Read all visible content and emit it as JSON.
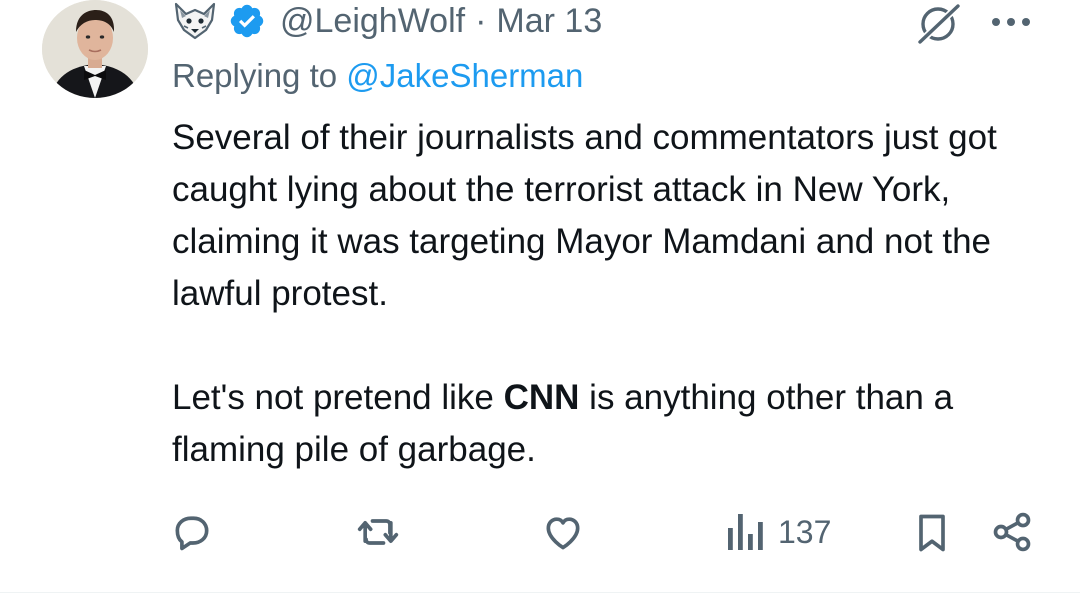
{
  "tweet": {
    "handle": "@LeighWolf",
    "separator": "·",
    "date": "Mar 13",
    "replying_prefix": "Replying to ",
    "replying_to": "@JakeSherman",
    "para1": "Several of their journalists and commentators just got caught lying about the terrorist attack in New York, claiming it was targeting Mayor Mamdani and not the lawful protest.",
    "para2_before": "Let's not pretend like ",
    "para2_bold": "CNN",
    "para2_after": " is anything other than a flaming pile of garbage."
  },
  "actions": {
    "reply_icon": "reply-icon",
    "retweet_icon": "retweet-icon",
    "like_icon": "heart-icon",
    "views_icon": "views-icon",
    "views_count": "137",
    "bookmark_icon": "bookmark-icon",
    "share_icon": "share-icon"
  },
  "colors": {
    "text": "#0f1419",
    "secondary": "#536471",
    "accent": "#1d9bf0"
  }
}
